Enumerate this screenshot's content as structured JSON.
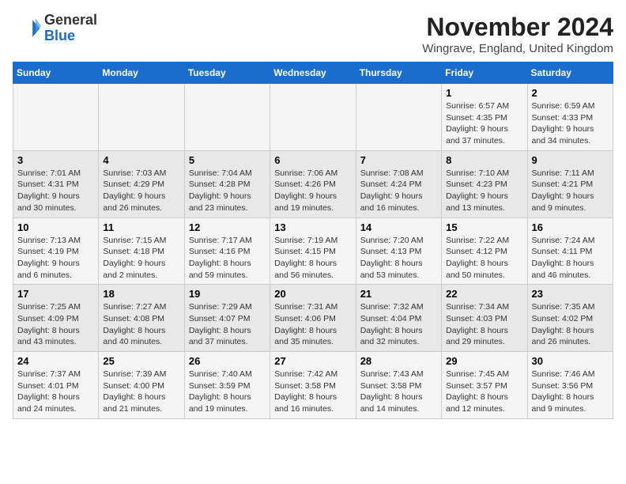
{
  "logo": {
    "general": "General",
    "blue": "Blue"
  },
  "title": "November 2024",
  "location": "Wingrave, England, United Kingdom",
  "headers": [
    "Sunday",
    "Monday",
    "Tuesday",
    "Wednesday",
    "Thursday",
    "Friday",
    "Saturday"
  ],
  "weeks": [
    [
      {
        "day": "",
        "info": ""
      },
      {
        "day": "",
        "info": ""
      },
      {
        "day": "",
        "info": ""
      },
      {
        "day": "",
        "info": ""
      },
      {
        "day": "",
        "info": ""
      },
      {
        "day": "1",
        "info": "Sunrise: 6:57 AM\nSunset: 4:35 PM\nDaylight: 9 hours and 37 minutes."
      },
      {
        "day": "2",
        "info": "Sunrise: 6:59 AM\nSunset: 4:33 PM\nDaylight: 9 hours and 34 minutes."
      }
    ],
    [
      {
        "day": "3",
        "info": "Sunrise: 7:01 AM\nSunset: 4:31 PM\nDaylight: 9 hours and 30 minutes."
      },
      {
        "day": "4",
        "info": "Sunrise: 7:03 AM\nSunset: 4:29 PM\nDaylight: 9 hours and 26 minutes."
      },
      {
        "day": "5",
        "info": "Sunrise: 7:04 AM\nSunset: 4:28 PM\nDaylight: 9 hours and 23 minutes."
      },
      {
        "day": "6",
        "info": "Sunrise: 7:06 AM\nSunset: 4:26 PM\nDaylight: 9 hours and 19 minutes."
      },
      {
        "day": "7",
        "info": "Sunrise: 7:08 AM\nSunset: 4:24 PM\nDaylight: 9 hours and 16 minutes."
      },
      {
        "day": "8",
        "info": "Sunrise: 7:10 AM\nSunset: 4:23 PM\nDaylight: 9 hours and 13 minutes."
      },
      {
        "day": "9",
        "info": "Sunrise: 7:11 AM\nSunset: 4:21 PM\nDaylight: 9 hours and 9 minutes."
      }
    ],
    [
      {
        "day": "10",
        "info": "Sunrise: 7:13 AM\nSunset: 4:19 PM\nDaylight: 9 hours and 6 minutes."
      },
      {
        "day": "11",
        "info": "Sunrise: 7:15 AM\nSunset: 4:18 PM\nDaylight: 9 hours and 2 minutes."
      },
      {
        "day": "12",
        "info": "Sunrise: 7:17 AM\nSunset: 4:16 PM\nDaylight: 8 hours and 59 minutes."
      },
      {
        "day": "13",
        "info": "Sunrise: 7:19 AM\nSunset: 4:15 PM\nDaylight: 8 hours and 56 minutes."
      },
      {
        "day": "14",
        "info": "Sunrise: 7:20 AM\nSunset: 4:13 PM\nDaylight: 8 hours and 53 minutes."
      },
      {
        "day": "15",
        "info": "Sunrise: 7:22 AM\nSunset: 4:12 PM\nDaylight: 8 hours and 50 minutes."
      },
      {
        "day": "16",
        "info": "Sunrise: 7:24 AM\nSunset: 4:11 PM\nDaylight: 8 hours and 46 minutes."
      }
    ],
    [
      {
        "day": "17",
        "info": "Sunrise: 7:25 AM\nSunset: 4:09 PM\nDaylight: 8 hours and 43 minutes."
      },
      {
        "day": "18",
        "info": "Sunrise: 7:27 AM\nSunset: 4:08 PM\nDaylight: 8 hours and 40 minutes."
      },
      {
        "day": "19",
        "info": "Sunrise: 7:29 AM\nSunset: 4:07 PM\nDaylight: 8 hours and 37 minutes."
      },
      {
        "day": "20",
        "info": "Sunrise: 7:31 AM\nSunset: 4:06 PM\nDaylight: 8 hours and 35 minutes."
      },
      {
        "day": "21",
        "info": "Sunrise: 7:32 AM\nSunset: 4:04 PM\nDaylight: 8 hours and 32 minutes."
      },
      {
        "day": "22",
        "info": "Sunrise: 7:34 AM\nSunset: 4:03 PM\nDaylight: 8 hours and 29 minutes."
      },
      {
        "day": "23",
        "info": "Sunrise: 7:35 AM\nSunset: 4:02 PM\nDaylight: 8 hours and 26 minutes."
      }
    ],
    [
      {
        "day": "24",
        "info": "Sunrise: 7:37 AM\nSunset: 4:01 PM\nDaylight: 8 hours and 24 minutes."
      },
      {
        "day": "25",
        "info": "Sunrise: 7:39 AM\nSunset: 4:00 PM\nDaylight: 8 hours and 21 minutes."
      },
      {
        "day": "26",
        "info": "Sunrise: 7:40 AM\nSunset: 3:59 PM\nDaylight: 8 hours and 19 minutes."
      },
      {
        "day": "27",
        "info": "Sunrise: 7:42 AM\nSunset: 3:58 PM\nDaylight: 8 hours and 16 minutes."
      },
      {
        "day": "28",
        "info": "Sunrise: 7:43 AM\nSunset: 3:58 PM\nDaylight: 8 hours and 14 minutes."
      },
      {
        "day": "29",
        "info": "Sunrise: 7:45 AM\nSunset: 3:57 PM\nDaylight: 8 hours and 12 minutes."
      },
      {
        "day": "30",
        "info": "Sunrise: 7:46 AM\nSunset: 3:56 PM\nDaylight: 8 hours and 9 minutes."
      }
    ]
  ]
}
